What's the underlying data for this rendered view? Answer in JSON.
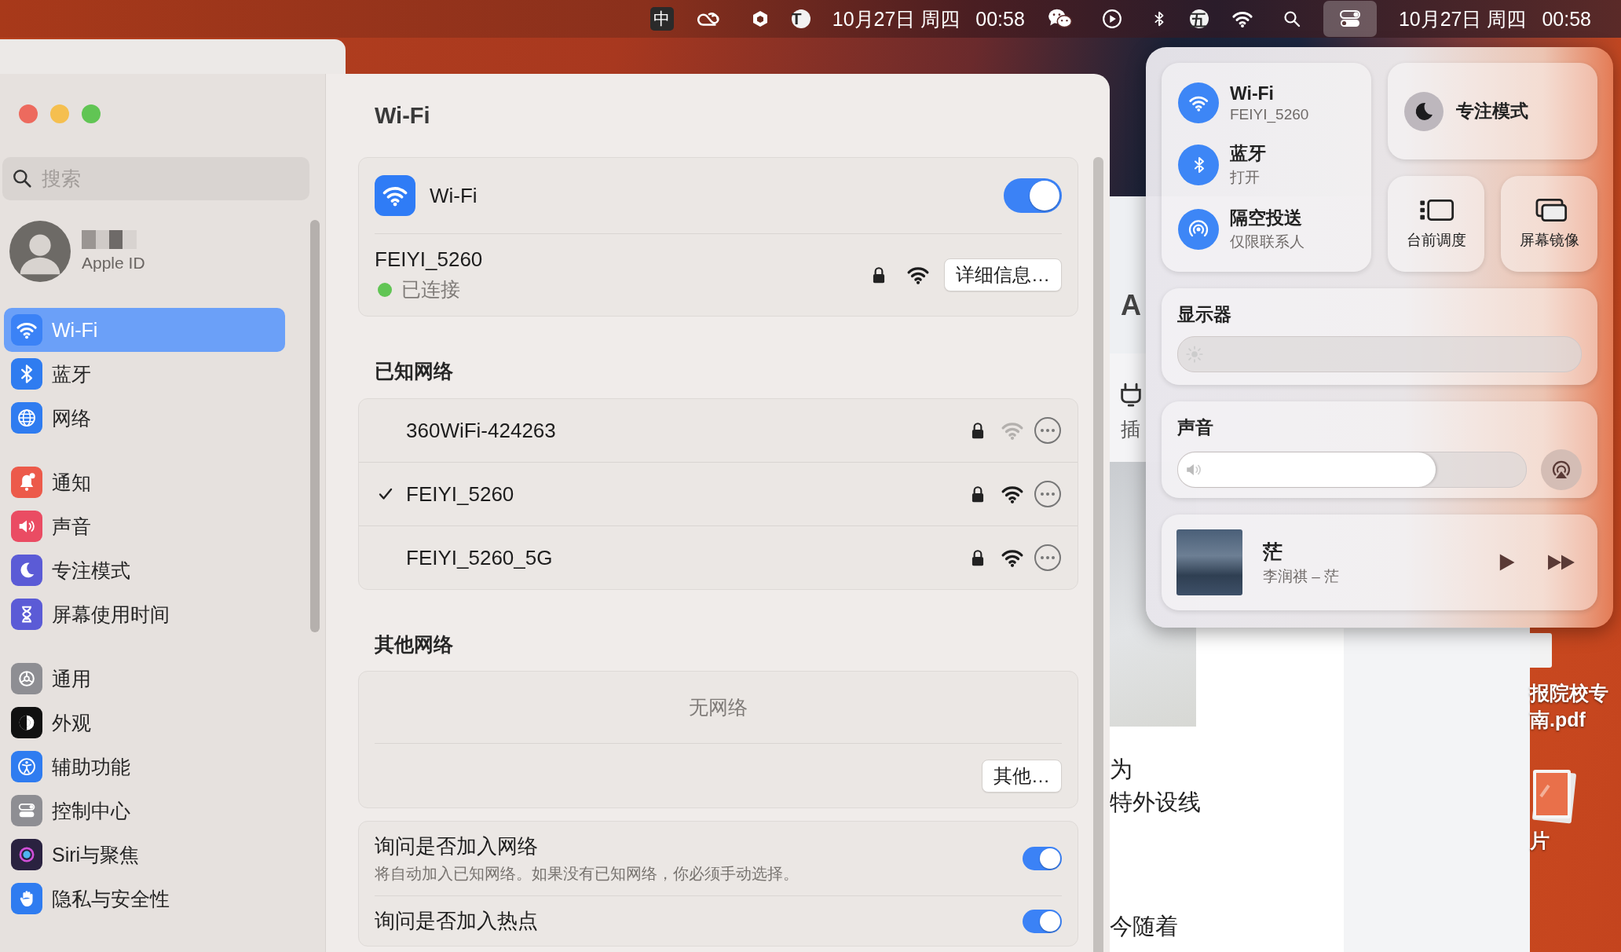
{
  "menu_bar": {
    "input_source": "中",
    "t_badge": "T",
    "date_1": "10月27日 周四",
    "time_1": "00:58",
    "ime_badge": "五",
    "control_center_active": true,
    "date_2": "10月27日 周四",
    "time_2": "00:58"
  },
  "settings_window": {
    "search": {
      "placeholder": "搜索"
    },
    "account": {
      "subtitle": "Apple ID"
    },
    "sidebar": {
      "groups": [
        {
          "items": [
            {
              "label": "Wi-Fi",
              "selected": true
            },
            {
              "label": "蓝牙",
              "selected": false
            },
            {
              "label": "网络",
              "selected": false
            }
          ]
        },
        {
          "items": [
            {
              "label": "通知",
              "selected": false
            },
            {
              "label": "声音",
              "selected": false
            },
            {
              "label": "专注模式",
              "selected": false
            },
            {
              "label": "屏幕使用时间",
              "selected": false
            }
          ]
        },
        {
          "items": [
            {
              "label": "通用",
              "selected": false
            },
            {
              "label": "外观",
              "selected": false
            },
            {
              "label": "辅助功能",
              "selected": false
            },
            {
              "label": "控制中心",
              "selected": false
            },
            {
              "label": "Siri与聚焦",
              "selected": false
            },
            {
              "label": "隐私与安全性",
              "selected": false
            }
          ]
        }
      ]
    },
    "title": "Wi-Fi",
    "wifi": {
      "label": "Wi-Fi",
      "on": true,
      "current": {
        "name": "FEIYI_5260",
        "status": "已连接",
        "connected": true,
        "details_button": "详细信息…"
      }
    },
    "known_networks": {
      "heading": "已知网络",
      "rows": [
        {
          "name": "360WiFi-424263",
          "connected": false,
          "weak_signal": true
        },
        {
          "name": "FEIYI_5260",
          "connected": true,
          "weak_signal": false
        },
        {
          "name": "FEIYI_5260_5G",
          "connected": false,
          "weak_signal": false
        }
      ]
    },
    "other_networks": {
      "heading": "其他网络",
      "empty": "无网络",
      "button": "其他…"
    },
    "options": [
      {
        "title": "询问是否加入网络",
        "description": "将自动加入已知网络。如果没有已知网络，你必须手动选择。",
        "on": true
      },
      {
        "title": "询问是否加入热点",
        "on": true
      }
    ]
  },
  "background_window": {
    "texts": [
      "A",
      "插",
      "为",
      "特外设线",
      "今随着"
    ]
  },
  "desktop": {
    "files": [
      {
        "label_lines": [
          "报院校专",
          "南.pdf"
        ],
        "kind": "document"
      },
      {
        "label_lines": [
          "片"
        ],
        "kind": "image"
      }
    ]
  },
  "control_center": {
    "connectivity": [
      {
        "kind": "wifi",
        "title": "Wi-Fi",
        "subtitle": "FEIYI_5260",
        "on": true
      },
      {
        "kind": "bluetooth",
        "title": "蓝牙",
        "subtitle": "打开",
        "on": true
      },
      {
        "kind": "airdrop",
        "title": "隔空投送",
        "subtitle": "仅限联系人",
        "on": true
      }
    ],
    "focus": {
      "label": "专注模式",
      "on": false
    },
    "tiles": [
      {
        "kind": "stage-manager",
        "label": "台前调度"
      },
      {
        "kind": "mirroring",
        "label": "屏幕镜像"
      }
    ],
    "display": {
      "title": "显示器",
      "level": 0
    },
    "sound": {
      "title": "声音",
      "level": 0.74
    },
    "now_playing": {
      "title": "茫",
      "subtitle": "李润祺 – 茫",
      "playing": false
    }
  }
}
